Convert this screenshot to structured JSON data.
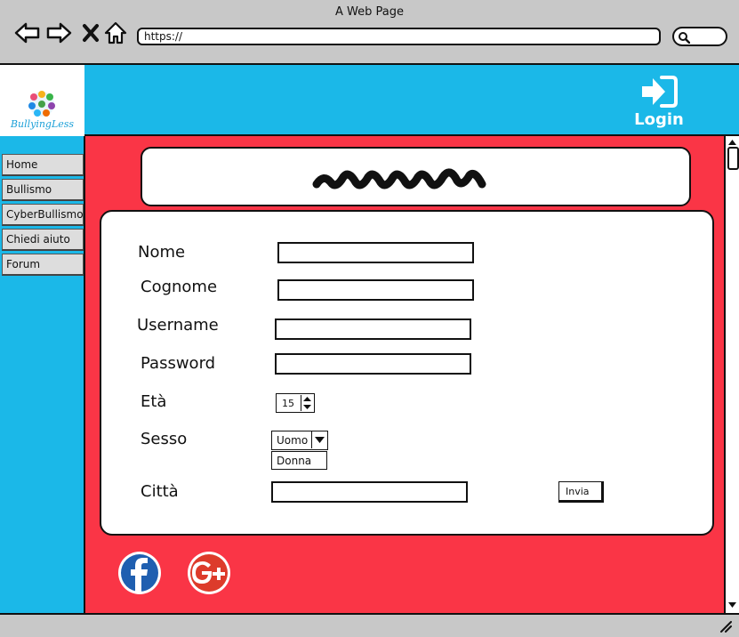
{
  "browser": {
    "title": "A Web Page",
    "url": "https://"
  },
  "header": {
    "logo_text": "BullyingLess",
    "login_label": "Login",
    "accent_color": "#1bb8e8"
  },
  "sidebar": {
    "items": [
      {
        "label": "Home"
      },
      {
        "label": "Bullismo"
      },
      {
        "label": "CyberBullismo"
      },
      {
        "label": "Chiedi aiuto"
      },
      {
        "label": "Forum"
      }
    ]
  },
  "main": {
    "background_color": "#fa3546"
  },
  "form": {
    "labels": {
      "nome": "Nome",
      "cognome": "Cognome",
      "username": "Username",
      "password": "Password",
      "eta": "Età",
      "sesso": "Sesso",
      "citta": "Città"
    },
    "age_value": "15",
    "sex_selected": "Uomo",
    "sex_option": "Donna",
    "submit_label": "Invia"
  },
  "social": {
    "icons": [
      "facebook-icon",
      "google-plus-icon"
    ]
  }
}
